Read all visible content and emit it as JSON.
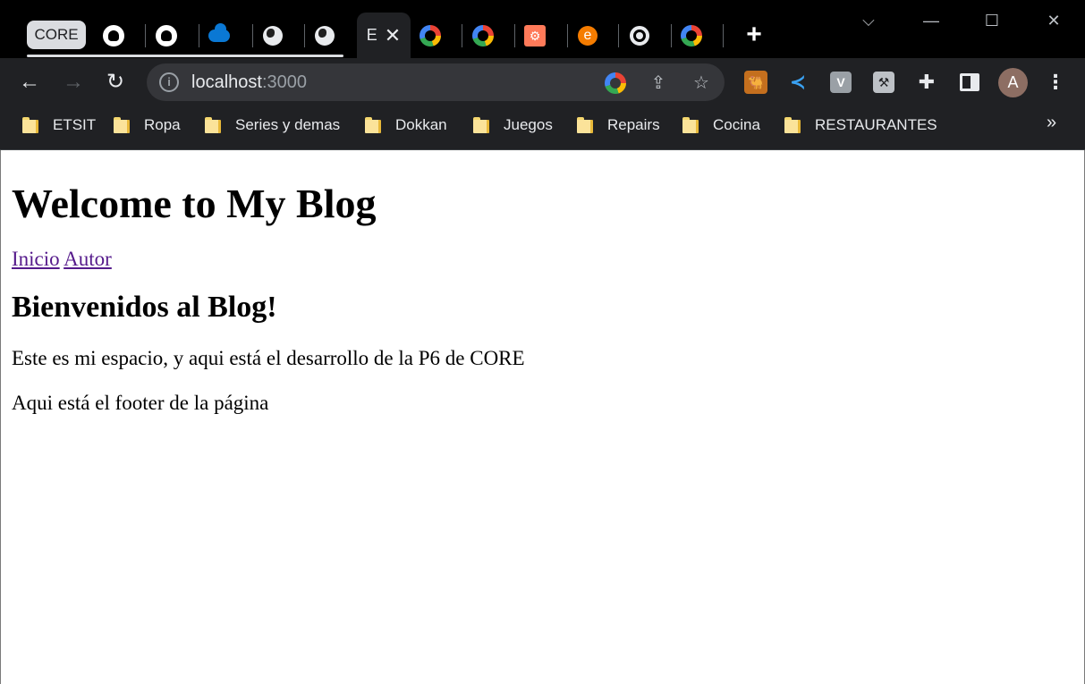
{
  "browser": {
    "tab_group_label": "CORE",
    "active_tab_letter": "E",
    "tabs": [
      {
        "icon": "github-icon"
      },
      {
        "icon": "github-icon"
      },
      {
        "icon": "onedrive-icon"
      },
      {
        "icon": "globe-icon"
      },
      {
        "icon": "globe-icon"
      },
      {
        "icon": "active"
      },
      {
        "icon": "google-icon"
      },
      {
        "icon": "google-icon"
      },
      {
        "icon": "hubspot-icon"
      },
      {
        "icon": "e-icon"
      },
      {
        "icon": "chrome-icon"
      },
      {
        "icon": "google-icon"
      }
    ],
    "close_glyph": "✕",
    "new_tab_glyph": "+",
    "url_host": "localhost",
    "url_port": ":3000",
    "profile_initial": "A",
    "hubspot_glyph": "⚙",
    "e_glyph": "e",
    "ext_v_letter": "V"
  },
  "bookmarks": [
    {
      "label": "ETSIT"
    },
    {
      "label": "Ropa"
    },
    {
      "label": "Series y demas"
    },
    {
      "label": "Dokkan"
    },
    {
      "label": "Juegos"
    },
    {
      "label": "Repairs"
    },
    {
      "label": "Cocina"
    },
    {
      "label": "RESTAURANTES"
    }
  ],
  "bookmarks_more": "»",
  "page": {
    "title": "Welcome to My Blog",
    "nav": [
      {
        "label": "Inicio"
      },
      {
        "label": "Autor"
      }
    ],
    "heading": "Bienvenidos al Blog!",
    "intro": "Este es mi espacio, y aqui está el desarrollo de la P6 de CORE",
    "footer": "Aqui está el footer de la página"
  },
  "colors": {
    "tabstrip": "#000000",
    "toolbar": "#202124",
    "omnibox": "#35363a",
    "visited_link": "#551a8b",
    "avatar": "#8d6e63"
  }
}
